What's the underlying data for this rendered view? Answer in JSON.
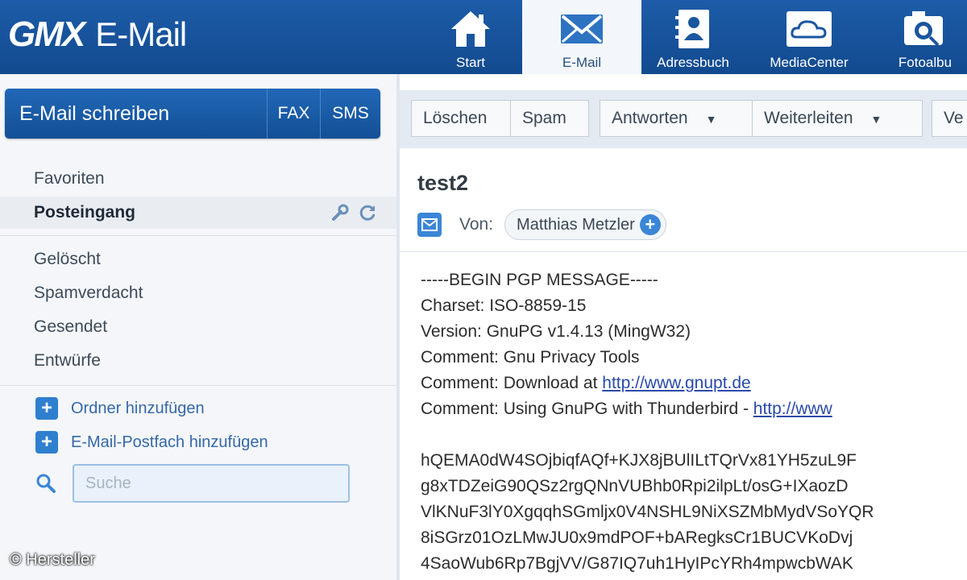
{
  "header": {
    "logo_brand": "GMX",
    "logo_product": "E-Mail",
    "nav": [
      {
        "label": "Start",
        "icon": "home-icon"
      },
      {
        "label": "E-Mail",
        "icon": "envelope-icon",
        "active": true
      },
      {
        "label": "Adressbuch",
        "icon": "address-book-icon"
      },
      {
        "label": "MediaCenter",
        "icon": "cloud-icon"
      },
      {
        "label": "Fotoalbu",
        "icon": "camera-icon"
      }
    ]
  },
  "sidebar": {
    "compose_label": "E-Mail schreiben",
    "fax_label": "FAX",
    "sms_label": "SMS",
    "folders": [
      "Favoriten",
      "Posteingang",
      "Gelöscht",
      "Spamverdacht",
      "Gesendet",
      "Entwürfe"
    ],
    "selected_folder": "Posteingang",
    "add_folder": "Ordner hinzufügen",
    "add_mailbox": "E-Mail-Postfach hinzufügen",
    "search_placeholder": "Suche"
  },
  "toolbar": {
    "delete": "Löschen",
    "spam": "Spam",
    "reply": "Antworten",
    "forward": "Weiterleiten",
    "more": "Ve"
  },
  "message": {
    "subject": "test2",
    "from_label": "Von:",
    "sender": "Matthias Metzler",
    "lines": [
      "-----BEGIN PGP MESSAGE-----",
      "Charset: ISO-8859-15",
      "Version: GnuPG v1.4.13 (MingW32)",
      "Comment: Gnu Privacy Tools"
    ],
    "download_prefix": "Comment: Download at ",
    "download_link": "http://www.gnupt.de",
    "thunderbird_prefix": "Comment: Using GnuPG with Thunderbird - ",
    "thunderbird_link": "http://www",
    "pgp_body": [
      "hQEMA0dW4SOjbiqfAQf+KJX8jBUlILtTQrVx81YH5zuL9F",
      "g8xTDZeiG90QSz2rgQNnVUBhb0Rpi2ilpLt/osG+IXaozD",
      "VlKNuF3lY0XgqqhSGmljx0V4NSHL9NiXSZMbMydVSoYQR",
      "8iSGrz01OzLMwJU0x9mdPOF+bARegksCr1BUCVKoDvj",
      "4SaoWub6Rp7BgjVV/G87IQ7uh1HyIPcYRh4mpwcbWAK"
    ]
  },
  "credit": "© Hersteller",
  "colors": {
    "header_blue": "#1d5ca8",
    "compose_blue": "#2168b7",
    "link_blue": "#2a4aa8",
    "accent_blue": "#3a86d6"
  }
}
